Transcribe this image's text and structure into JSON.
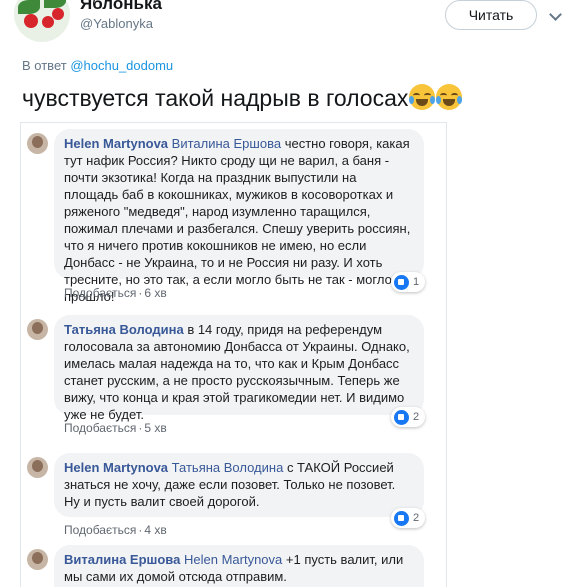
{
  "tweet": {
    "display_name": "Яблонька",
    "handle": "@Yablonyka",
    "follow_label": "Читать",
    "reply_prefix": "В ответ",
    "reply_to": "@hochu_dodomu",
    "text": "чувствуется такой надрыв в голосах",
    "emoji_icon": "face-with-tears-of-joy"
  },
  "comments": [
    {
      "author": "Helen Martynova",
      "mention": "Виталина Ершова",
      "text": "честно говоря, какая тут нафик Россия? Никто сроду щи не варил, а баня - почти экзотика! Когда на праздник выпустили на площадь баб в кокошниках, мужиков в косоворотках и ряженого \"медведя\", народ изумленно таращился, пожимал плечами и разбегался. Спешу уверить россиян, что я ничего против кокошников не имею, но если Донбасс - не Украина, то и не Россия ни разу. И хоть тресните, но это так, а если могло быть не так - могло, да прошло!",
      "like_label": "Подобається",
      "time": "6 хв",
      "reactions": "1"
    },
    {
      "author": "Татьяна Володина",
      "mention": "",
      "text": "в 14 году, придя на референдум голосовала за автономию Донбасса от Украины. Однако, имелась малая надежда на то, что как и Крым Донбасс станет русским, а не просто русскоязычным. Теперь же вижу, что конца и края этой трагикомедии нет. И видимо уже не будет.",
      "like_label": "Подобається",
      "time": "5 хв",
      "reactions": "2"
    },
    {
      "author": "Helen Martynova",
      "mention": "Татьяна Володина",
      "text": "с ТАКОЙ Россией знаться не хочу, даже если позовет. Только не позовет. Ну и пусть валит своей дорогой.",
      "like_label": "Подобається",
      "time": "4 хв",
      "reactions": "2"
    },
    {
      "author": "Виталина Ершова",
      "mention": "Helen Martynova",
      "text": "+1 пусть валит, или мы сами их домой отсюда отправим.",
      "like_label": "",
      "time": "",
      "reactions": ""
    }
  ]
}
